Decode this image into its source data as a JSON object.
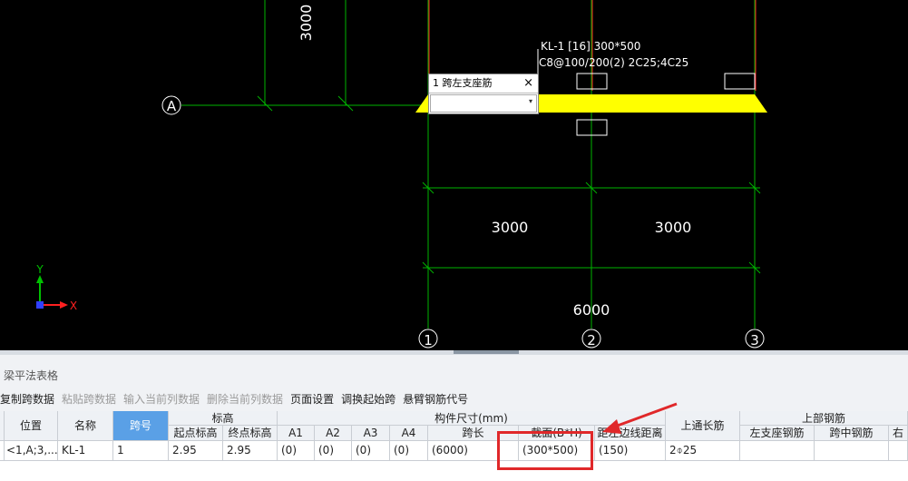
{
  "cad": {
    "axis_a": "A",
    "axis_1": "1",
    "axis_2": "2",
    "axis_3": "3",
    "dim_vertical": "3000",
    "dim_span1": "3000",
    "dim_span2": "3000",
    "dim_total": "6000",
    "beam_label_line1": "KL-1 [16] 300*500",
    "beam_label_line2": "C8@100/200(2) 2C25;4C25",
    "ucs_y": "Y",
    "ucs_x": "X",
    "colors": {
      "beam": "#ffff00",
      "grid_line": "#00b300",
      "axis_red": "#ff2020",
      "highlight": "#e0282a"
    }
  },
  "popup": {
    "title": "1 跨左支座筋",
    "close": "×",
    "input_value": "",
    "dropdown_arrow": "▾"
  },
  "panel": {
    "title": "梁平法表格",
    "toolbar": [
      {
        "label": "复制跨数据",
        "enabled": true
      },
      {
        "label": "粘贴跨数据",
        "enabled": false
      },
      {
        "label": "输入当前列数据",
        "enabled": false
      },
      {
        "label": "删除当前列数据",
        "enabled": false
      },
      {
        "label": "页面设置",
        "enabled": true
      },
      {
        "label": "调换起始跨",
        "enabled": true
      },
      {
        "label": "悬臂钢筋代号",
        "enabled": true
      }
    ],
    "headers": {
      "position": "位置",
      "name": "名称",
      "span_no": "跨号",
      "elev_group": "标高",
      "elev_start": "起点标高",
      "elev_end": "终点标高",
      "size_group": "构件尺寸(mm)",
      "a1": "A1",
      "a2": "A2",
      "a3": "A3",
      "a4": "A4",
      "span_len": "跨长",
      "section": "截面(B*H)",
      "offset": "距左边线距离",
      "top_long": "上通长筋",
      "top_group": "上部钢筋",
      "left_support": "左支座钢筋",
      "mid_span": "跨中钢筋",
      "right": "右"
    },
    "row": {
      "position": "<1,A;3,...",
      "name": "KL-1",
      "span_no": "1",
      "elev_start": "2.95",
      "elev_end": "2.95",
      "a1": "(0)",
      "a2": "(0)",
      "a3": "(0)",
      "a4": "(0)",
      "span_len": "(6000)",
      "section": "(300*500)",
      "offset": "(150)",
      "top_long": "2⌽25"
    }
  }
}
